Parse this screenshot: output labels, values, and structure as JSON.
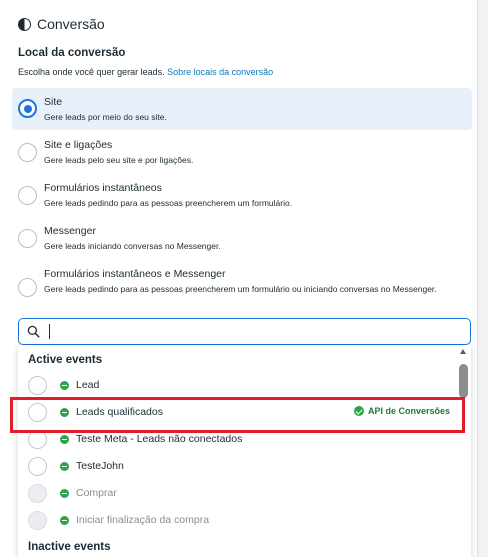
{
  "section": {
    "title": "Conversão",
    "icon": "half-circle-icon"
  },
  "location": {
    "label": "Local da conversão",
    "description": "Escolha onde você quer gerar leads.",
    "link_text": "Sobre locais da conversão"
  },
  "options": [
    {
      "title": "Site",
      "description": "Gere leads por meio do seu site.",
      "selected": true
    },
    {
      "title": "Site e ligações",
      "description": "Gere leads pelo seu site e por ligações.",
      "selected": false
    },
    {
      "title": "Formulários instantâneos",
      "description": "Gere leads pedindo para as pessoas preencherem um formulário.",
      "selected": false
    },
    {
      "title": "Messenger",
      "description": "Gere leads iniciando conversas no Messenger.",
      "selected": false
    },
    {
      "title": "Formulários instantâneos e Messenger",
      "description": "Gere leads pedindo para as pessoas preencherem um formulário ou iniciando conversas no Messenger.",
      "selected": false
    }
  ],
  "search": {
    "value": "",
    "placeholder": ""
  },
  "events": {
    "active_heading": "Active events",
    "inactive_heading": "Inactive events",
    "items": [
      {
        "name": "Lead",
        "status": "active",
        "disabled": false
      },
      {
        "name": "Leads qualificados",
        "status": "active",
        "disabled": false,
        "badge": "API de Conversões"
      },
      {
        "name": "Teste Meta - Leads não conectados",
        "status": "active",
        "disabled": false
      },
      {
        "name": "TesteJohn",
        "status": "active",
        "disabled": false
      },
      {
        "name": "Comprar",
        "status": "active",
        "disabled": true
      },
      {
        "name": "Iniciar finalização da compra",
        "status": "active",
        "disabled": true
      }
    ]
  },
  "colors": {
    "accent": "#1b74e4",
    "active_green": "#31a24c",
    "highlight_red": "#e11d2b",
    "link": "#0a78be"
  }
}
